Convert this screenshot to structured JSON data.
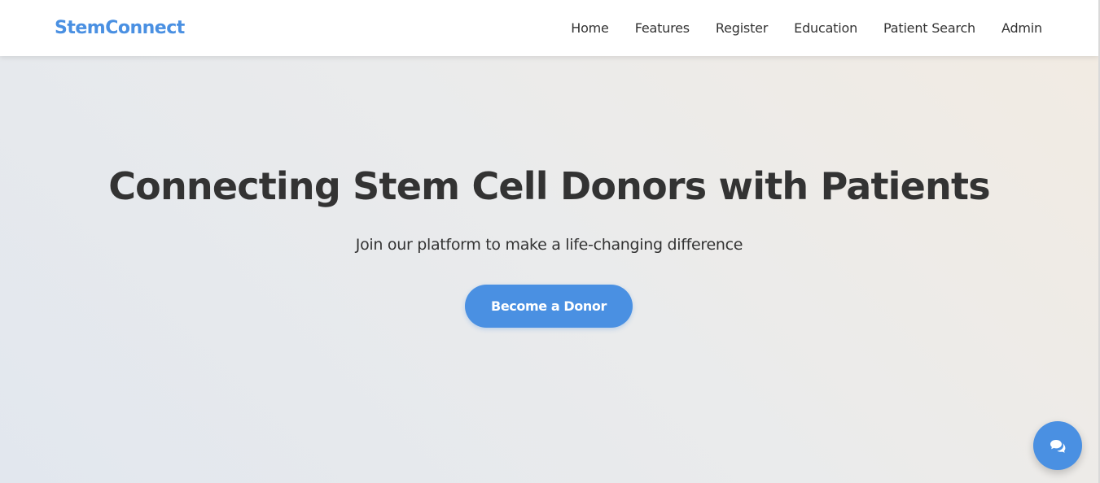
{
  "brand": {
    "name": "StemConnect"
  },
  "nav": {
    "items": [
      {
        "label": "Home"
      },
      {
        "label": "Features"
      },
      {
        "label": "Register"
      },
      {
        "label": "Education"
      },
      {
        "label": "Patient Search"
      },
      {
        "label": "Admin"
      }
    ]
  },
  "hero": {
    "title": "Connecting Stem Cell Donors with Patients",
    "subtitle": "Join our platform to make a life-changing difference",
    "cta_label": "Become a Donor"
  },
  "chat": {
    "icon": "comments-icon"
  },
  "colors": {
    "accent": "#4a90e2",
    "text": "#333333",
    "navbar_bg": "#ffffff"
  }
}
